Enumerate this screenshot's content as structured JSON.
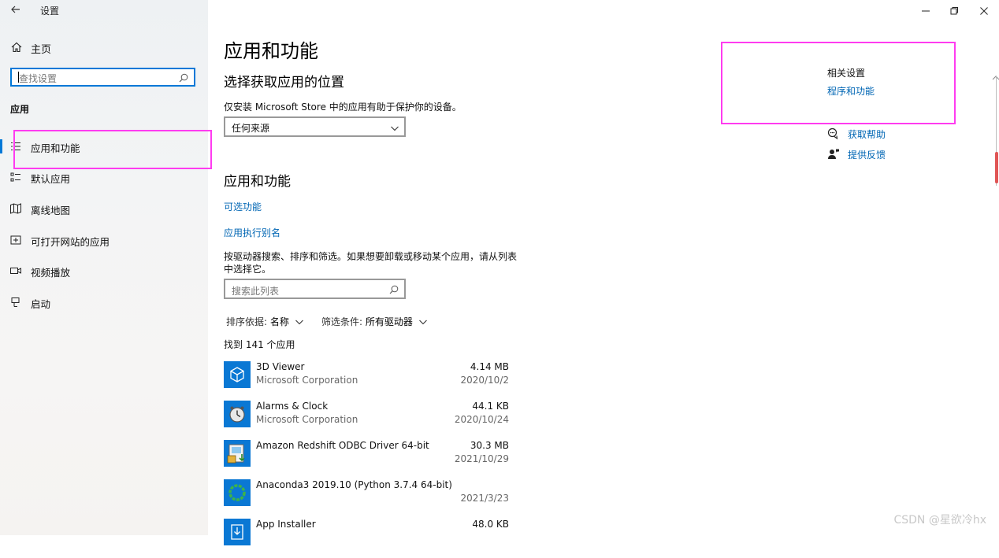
{
  "window": {
    "title": "设置",
    "back_icon": "back-arrow-icon",
    "controls": [
      "minimize-icon",
      "restore-icon",
      "close-icon"
    ]
  },
  "sidebar": {
    "home_label": "主页",
    "search_placeholder": "查找设置",
    "section_label": "应用",
    "items": [
      {
        "label": "应用和功能",
        "icon": "apps-list-icon",
        "active": true
      },
      {
        "label": "默认应用",
        "icon": "default-apps-icon"
      },
      {
        "label": "离线地图",
        "icon": "offline-maps-icon"
      },
      {
        "label": "可打开网站的应用",
        "icon": "apps-for-websites-icon"
      },
      {
        "label": "视频播放",
        "icon": "video-playback-icon"
      },
      {
        "label": "启动",
        "icon": "startup-icon"
      }
    ]
  },
  "main": {
    "page_title": "应用和功能",
    "install_section": {
      "heading": "选择获取应用的位置",
      "description": "仅安装 Microsoft Store 中的应用有助于保护你的设备。",
      "dropdown_value": "任何来源"
    },
    "apps_section": {
      "heading": "应用和功能",
      "optional_features_link": "可选功能",
      "app_alias_link": "应用执行别名",
      "instructions": "按驱动器搜索、排序和筛选。如果想要卸载或移动某个应用，请从列表中选择它。",
      "search_placeholder": "搜索此列表",
      "sort_label": "排序依据:",
      "sort_value": "名称",
      "filter_label": "筛选条件:",
      "filter_value": "所有驱动器",
      "found_count": "找到 141 个应用",
      "apps": [
        {
          "name": "3D Viewer",
          "publisher": "Microsoft Corporation",
          "size": "4.14 MB",
          "date": "2020/10/2",
          "icon": "3d-viewer-icon"
        },
        {
          "name": "Alarms & Clock",
          "publisher": "Microsoft Corporation",
          "size": "44.1 KB",
          "date": "2020/10/24",
          "icon": "alarms-clock-icon"
        },
        {
          "name": "Amazon Redshift ODBC Driver 64-bit",
          "publisher": "",
          "size": "30.3 MB",
          "date": "2021/10/29",
          "icon": "installer-package-icon"
        },
        {
          "name": "Anaconda3 2019.10 (Python 3.7.4 64-bit)",
          "publisher": "",
          "size": "",
          "date": "2021/3/23",
          "icon": "anaconda-icon"
        },
        {
          "name": "App Installer",
          "publisher": "",
          "size": "48.0 KB",
          "date": "",
          "icon": "app-installer-icon"
        }
      ]
    }
  },
  "related": {
    "heading": "相关设置",
    "programs_link": "程序和功能",
    "get_help": "获取帮助",
    "give_feedback": "提供反馈"
  },
  "colors": {
    "accent": "#0078d7",
    "link": "#0066b4",
    "highlight": "#ff3cf0"
  },
  "watermark": "CSDN @星欲冷hx"
}
